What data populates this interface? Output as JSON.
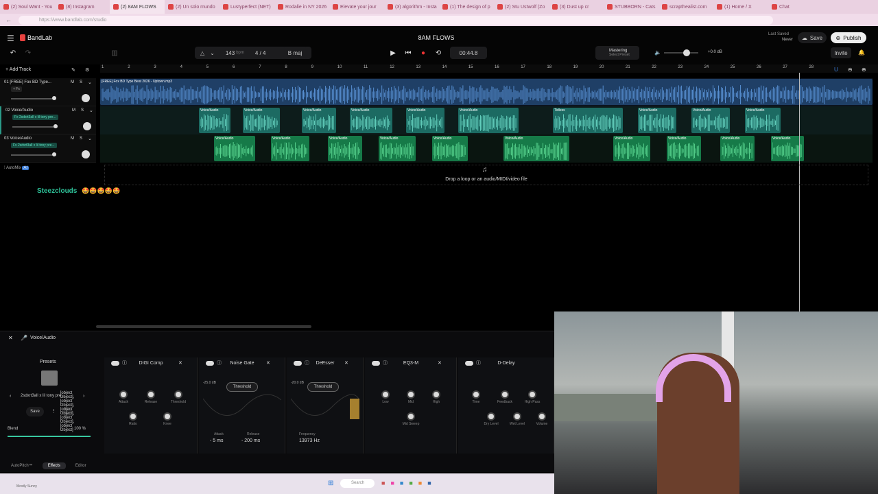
{
  "browser": {
    "tabs": [
      "(2) Soul Want - You",
      "(8) Instagram",
      "(2) 8AM FLOWS",
      "(2) Un solo mundo",
      "Lustyperfect (NET)",
      "Rodalie in NY 2026",
      "Elevate your jour",
      "(3) algorithm - Insta",
      "(1) The design of p",
      "(2) Stu Ustwolf (Zo",
      "(3) Dust up cr",
      "STUBBORN - Cats",
      "scrapthealist.com",
      "(1) Home / X",
      "Chat"
    ],
    "url": "https://www.bandlab.com/studio"
  },
  "app": {
    "logo": "BandLab",
    "project_title": "8AM FLOWS",
    "last_saved_label": "Last Saved",
    "last_saved_value": "Never",
    "save": "Save",
    "publish": "Publish",
    "invite": "Invite"
  },
  "transport": {
    "bpm": "143",
    "bpm_unit": "bpm",
    "time_sig": "4 / 4",
    "key": "B maj",
    "time": "00:44.8",
    "mastering": "Mastering",
    "mastering_sub": "Select Preset",
    "volume_db": "+0.0 dB"
  },
  "ruler": [
    "1",
    "2",
    "3",
    "4",
    "5",
    "6",
    "7",
    "8",
    "9",
    "10",
    "11",
    "12",
    "13",
    "14",
    "15",
    "16",
    "17",
    "18",
    "19",
    "20",
    "21",
    "22",
    "23",
    "24",
    "25",
    "26",
    "27",
    "28"
  ],
  "add_track": "Add Track",
  "tracks": [
    {
      "name": "01 [FREE] Fox BD Type...",
      "fx": "+ Fx",
      "clip_name": "[FREE] Fox BD Type Beat 2026 - Uptown.mp3",
      "color": "#3b6fb0"
    },
    {
      "name": "02 Voice/Audio",
      "fx": "Fx 2sdxrt3all x lil tony pre...",
      "clip_label": "Voice/Audio",
      "color": "#2a9a88"
    },
    {
      "name": "03 Voice/Audio",
      "fx": "Fx 2sdxrt3all x lil tony pre...",
      "clip_label": "Voice/Audio",
      "color": "#1d9a5b"
    }
  ],
  "track2_clip_labels": [
    "Voice/Audio",
    "Voice/Audio",
    "Voice/Audio",
    "Voice/Audio",
    "Voice/Audio",
    "Voice/Audio",
    "Tidless",
    "Voice/Audio",
    "Voice/Audio",
    "Voice/Audio"
  ],
  "automix": "AutoMix",
  "automix_badge": "AI",
  "drop_hint": "Drop a loop or an audio/MIDI/video file",
  "chat": {
    "user": "Steezclouds",
    "emojis": "🤩🤩🤩🤩🤩"
  },
  "bottom": {
    "track": "Voice/Audio",
    "presets_title": "Presets",
    "preset_name": "2sdxrt3all x lil tony pre...",
    "save": "Save",
    "fx": [
      {
        "name": "DIGI Comp",
        "knobs": [
          "Attack",
          "Release",
          "Threshold",
          "Ratio",
          "Knee"
        ]
      },
      {
        "name": "Noise Gate",
        "threshold": "Threshold",
        "db": "-25.0 dB",
        "attack_label": "Attack",
        "attack": "5 ms",
        "release_label": "Release",
        "release": "200 ms"
      },
      {
        "name": "DeEsser",
        "threshold": "Threshold",
        "db": "-20.0 dB",
        "freq_label": "Frequency",
        "freq": "13973 Hz"
      },
      {
        "name": "EQ3-M",
        "knobs": [
          "Low",
          "Mid",
          "High",
          "Mid Sweep"
        ]
      },
      {
        "name": "D-Delay",
        "knobs": [
          "Time",
          "Feedback",
          "High Pass",
          "Dry Level",
          "Wet Level",
          "Volume"
        ]
      }
    ],
    "blend_label": "Blend",
    "blend_value": "100 %",
    "blend_fraction": 1.0,
    "tabs": [
      "AutoPitch™",
      "Effects",
      "Editor"
    ]
  },
  "taskbar": {
    "weather": "Mostly Sunny",
    "search": "Search"
  }
}
